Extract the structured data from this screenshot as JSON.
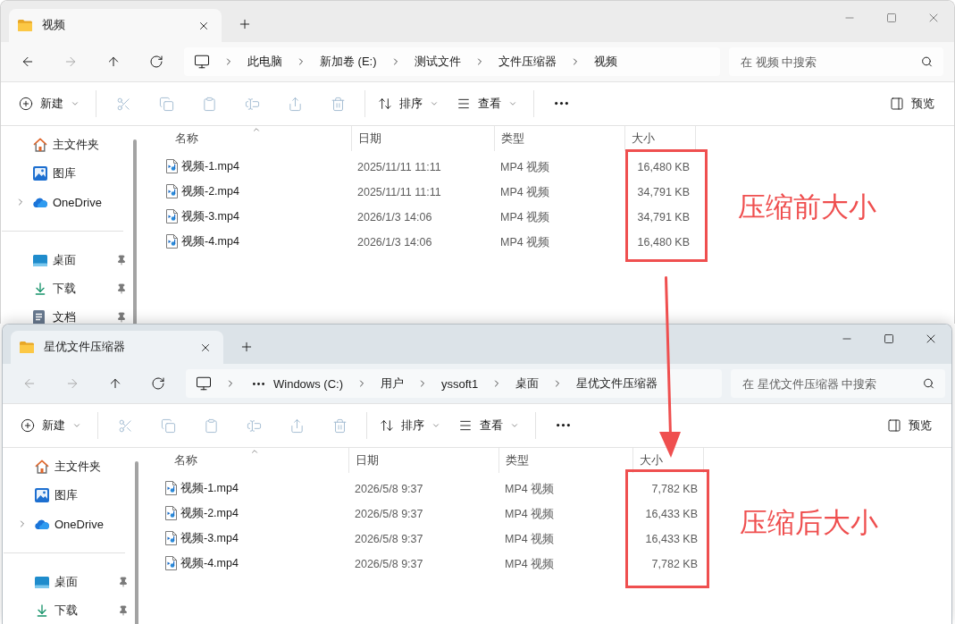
{
  "windows": [
    {
      "active": false,
      "tab": {
        "title": "视频"
      },
      "nav_buttons": [
        {
          "kind": "back",
          "disabled": false
        },
        {
          "kind": "forward",
          "disabled": true
        },
        {
          "kind": "up",
          "disabled": false
        },
        {
          "kind": "refresh",
          "disabled": false
        }
      ],
      "breadcrumb": {
        "overflow": false,
        "items": [
          "此电脑",
          "新加卷 (E:)",
          "测试文件",
          "文件压缩器",
          "视频"
        ]
      },
      "search": {
        "placeholder": "在 视频 中搜索"
      },
      "toolbar": [
        {
          "kind": "new",
          "label": "新建",
          "disabled": false
        },
        {
          "kind": "cut",
          "disabled": true
        },
        {
          "kind": "copy",
          "disabled": true
        },
        {
          "kind": "paste",
          "disabled": true
        },
        {
          "kind": "rename",
          "disabled": true
        },
        {
          "kind": "share",
          "disabled": true
        },
        {
          "kind": "delete",
          "disabled": true
        },
        {
          "kind": "sort",
          "label": "排序",
          "disabled": false
        },
        {
          "kind": "view",
          "label": "查看",
          "disabled": false
        },
        {
          "kind": "more",
          "disabled": false
        }
      ],
      "preview": {
        "label": "预览"
      },
      "sidebar": {
        "groups": [
          [
            {
              "kind": "home",
              "label": "主文件夹",
              "pinned": false
            },
            {
              "kind": "gallery",
              "label": "图库",
              "pinned": false
            },
            {
              "kind": "cloud",
              "label": "OneDrive",
              "pinned": false,
              "expanded": false
            }
          ],
          [
            {
              "kind": "desktop",
              "label": "桌面",
              "pinned": true
            },
            {
              "kind": "downloads",
              "label": "下载",
              "pinned": true
            },
            {
              "kind": "documents",
              "label": "文档",
              "pinned": true
            }
          ]
        ]
      },
      "columns": [
        {
          "label": "名称",
          "sorted": true
        },
        {
          "label": "日期",
          "sorted": false
        },
        {
          "label": "类型",
          "sorted": false
        },
        {
          "label": "大小",
          "sorted": false
        }
      ],
      "rows": [
        {
          "name": "视频-1.mp4",
          "date": "2025/11/11 11:11",
          "type": "MP4 视频",
          "size": "16,480 KB"
        },
        {
          "name": "视频-2.mp4",
          "date": "2025/11/11 11:11",
          "type": "MP4 视频",
          "size": "34,791 KB"
        },
        {
          "name": "视频-3.mp4",
          "date": "2026/1/3 14:06",
          "type": "MP4 视频",
          "size": "34,791 KB"
        },
        {
          "name": "视频-4.mp4",
          "date": "2026/1/3 14:06",
          "type": "MP4 视频",
          "size": "16,480 KB"
        }
      ],
      "annotation": {
        "label": "压缩前大小"
      }
    },
    {
      "active": true,
      "tab": {
        "title": "星优文件压缩器"
      },
      "nav_buttons": [
        {
          "kind": "back",
          "disabled": true
        },
        {
          "kind": "forward",
          "disabled": true
        },
        {
          "kind": "up",
          "disabled": false
        },
        {
          "kind": "refresh",
          "disabled": false
        }
      ],
      "breadcrumb": {
        "overflow": true,
        "items": [
          "Windows (C:)",
          "用户",
          "yssoft1",
          "桌面",
          "星优文件压缩器"
        ]
      },
      "search": {
        "placeholder": "在 星优文件压缩器 中搜索"
      },
      "toolbar": [
        {
          "kind": "new",
          "label": "新建",
          "disabled": false
        },
        {
          "kind": "cut",
          "disabled": true
        },
        {
          "kind": "copy",
          "disabled": true
        },
        {
          "kind": "paste",
          "disabled": true
        },
        {
          "kind": "rename",
          "disabled": true
        },
        {
          "kind": "share",
          "disabled": true
        },
        {
          "kind": "delete",
          "disabled": true
        },
        {
          "kind": "sort",
          "label": "排序",
          "disabled": false
        },
        {
          "kind": "view",
          "label": "查看",
          "disabled": false
        },
        {
          "kind": "more",
          "disabled": false
        }
      ],
      "preview": {
        "label": "预览"
      },
      "sidebar": {
        "groups": [
          [
            {
              "kind": "home",
              "label": "主文件夹",
              "pinned": false
            },
            {
              "kind": "gallery",
              "label": "图库",
              "pinned": false
            },
            {
              "kind": "cloud",
              "label": "OneDrive",
              "pinned": false,
              "expanded": false
            }
          ],
          [
            {
              "kind": "desktop",
              "label": "桌面",
              "pinned": true
            },
            {
              "kind": "downloads",
              "label": "下载",
              "pinned": true
            }
          ]
        ]
      },
      "columns": [
        {
          "label": "名称",
          "sorted": true
        },
        {
          "label": "日期",
          "sorted": false
        },
        {
          "label": "类型",
          "sorted": false
        },
        {
          "label": "大小",
          "sorted": false
        }
      ],
      "rows": [
        {
          "name": "视频-1.mp4",
          "date": "2026/5/8 9:37",
          "type": "MP4 视频",
          "size": "7,782 KB"
        },
        {
          "name": "视频-2.mp4",
          "date": "2026/5/8 9:37",
          "type": "MP4 视频",
          "size": "16,433 KB"
        },
        {
          "name": "视频-3.mp4",
          "date": "2026/5/8 9:37",
          "type": "MP4 视频",
          "size": "16,433 KB"
        },
        {
          "name": "视频-4.mp4",
          "date": "2026/5/8 9:37",
          "type": "MP4 视频",
          "size": "7,782 KB"
        }
      ],
      "annotation": {
        "label": "压缩后大小"
      }
    }
  ]
}
